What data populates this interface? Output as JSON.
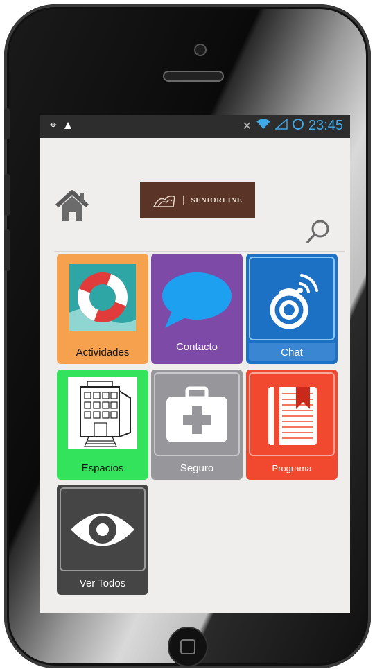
{
  "status_bar": {
    "left_icons": [
      "gps-icon",
      "warning-icon"
    ],
    "right_icons": [
      "mute-icon",
      "wifi-icon",
      "signal-icon",
      "sync-icon"
    ],
    "time": "23:45"
  },
  "header": {
    "logo_text": "SENIORLINE"
  },
  "tiles": [
    {
      "label": "Actividades",
      "icon": "lifebuoy-icon",
      "color": "#f5a04c"
    },
    {
      "label": "Contacto",
      "icon": "speech-bubble-icon",
      "color": "#7e4aa8"
    },
    {
      "label": "Chat",
      "icon": "webcam-icon",
      "color": "#1d71c4"
    },
    {
      "label": "Espacios",
      "icon": "building-icon",
      "color": "#33e25b"
    },
    {
      "label": "Seguro",
      "icon": "first-aid-kit-icon",
      "color": "#97969b"
    },
    {
      "label": "Programa",
      "icon": "notebook-icon",
      "color": "#f0492f"
    },
    {
      "label": "Ver Todos",
      "icon": "eye-icon",
      "color": "#454545"
    }
  ]
}
